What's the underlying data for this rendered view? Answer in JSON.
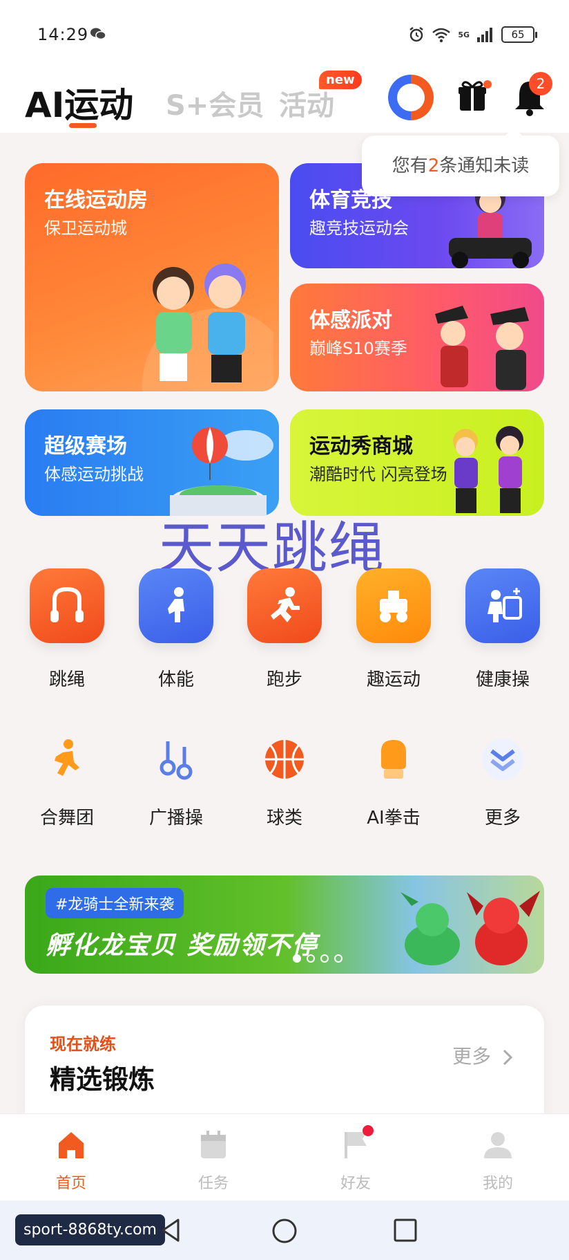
{
  "status_bar": {
    "time": "14:29",
    "network": "5G",
    "battery": "65"
  },
  "header": {
    "tabs": [
      {
        "label": "AI运动",
        "active": true
      },
      {
        "label": "S+会员",
        "active": false
      },
      {
        "label": "活动",
        "active": false
      }
    ],
    "new_badge": "new",
    "notification_count": "2"
  },
  "notice": {
    "prefix": "您有",
    "count": "2",
    "suffix": "条通知未读"
  },
  "cards": {
    "online": {
      "title": "在线运动房",
      "sub": "保卫运动城"
    },
    "sports": {
      "title": "体育竞技",
      "sub": "趣竞技运动会"
    },
    "party": {
      "title": "体感派对",
      "sub": "巅峰S10赛季"
    },
    "arena": {
      "title": "超级赛场",
      "sub": "体感运动挑战"
    },
    "shop": {
      "title": "运动秀商城",
      "sub": "潮酷时代 闪亮登场"
    }
  },
  "overlay_text": "天天跳绳",
  "grid_row1": [
    {
      "label": "跳绳",
      "icon": "jump-rope-icon",
      "color": "#f25a1f"
    },
    {
      "label": "体能",
      "icon": "fitness-icon",
      "color": "#3b6cf2"
    },
    {
      "label": "跑步",
      "icon": "running-icon",
      "color": "#f25a1f"
    },
    {
      "label": "趣运动",
      "icon": "fun-sports-icon",
      "color": "#ff9a1a"
    },
    {
      "label": "健康操",
      "icon": "health-exercise-icon",
      "color": "#3b6cf2"
    }
  ],
  "grid_row2": [
    {
      "label": "合舞团",
      "icon": "dance-icon"
    },
    {
      "label": "广播操",
      "icon": "broadcast-exercise-icon"
    },
    {
      "label": "球类",
      "icon": "ball-icon"
    },
    {
      "label": "AI拳击",
      "icon": "boxing-glove-icon"
    },
    {
      "label": "更多",
      "icon": "more-chevron-icon"
    }
  ],
  "banner": {
    "tag": "#龙骑士全新来袭",
    "text": "孵化龙宝贝  奖励领不停"
  },
  "practice": {
    "kicker": "现在就练",
    "title": "精选锻炼",
    "more": "更多"
  },
  "bottom_nav": [
    {
      "label": "首页",
      "active": true
    },
    {
      "label": "任务",
      "active": false
    },
    {
      "label": "好友",
      "active": false
    },
    {
      "label": "我的",
      "active": false
    }
  ],
  "url_badge": "sport-8868ty.com"
}
